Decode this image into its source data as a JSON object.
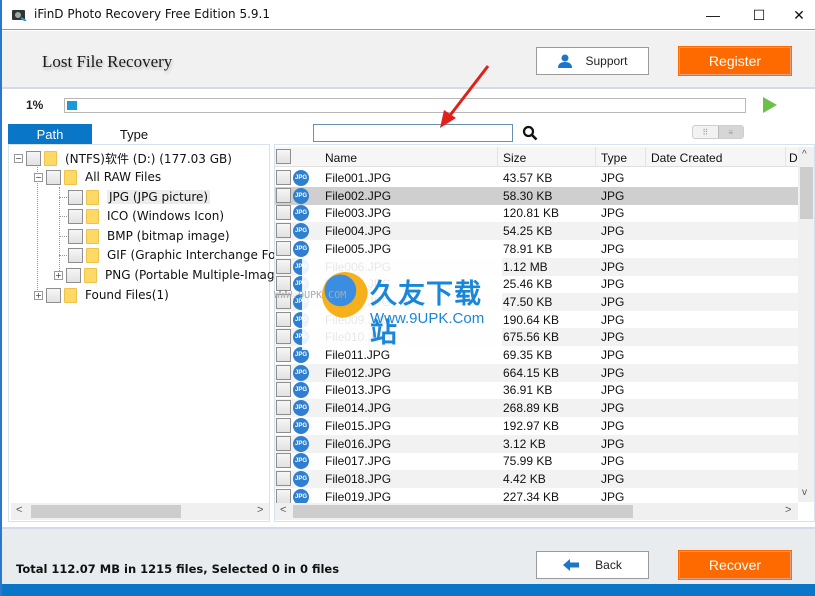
{
  "window": {
    "title": "iFinD Photo Recovery Free Edition 5.9.1",
    "controls": {
      "minimize": "—",
      "maximize": "☐",
      "close": "✕"
    }
  },
  "header": {
    "title": "Lost File Recovery",
    "support_label": "Support",
    "register_label": "Register"
  },
  "progress": {
    "percent_label": "1%",
    "value_percent": 1
  },
  "tabs": [
    {
      "label": "Path",
      "active": true
    },
    {
      "label": "Type",
      "active": false
    }
  ],
  "search": {
    "value": "",
    "placeholder": ""
  },
  "view_toggle": {
    "grid": "⠿",
    "list": "≡",
    "active": "list"
  },
  "tree": {
    "drive": "(NTFS)软件 (D:) (177.03 GB)",
    "raw_group": "All RAW Files",
    "types": [
      {
        "label": "JPG (JPG picture)",
        "selected": true
      },
      {
        "label": "ICO (Windows Icon)"
      },
      {
        "label": "BMP (bitmap image)"
      },
      {
        "label": "GIF (Graphic Interchange For"
      },
      {
        "label": "PNG (Portable Multiple-Imag"
      }
    ],
    "found": "Found Files(1)"
  },
  "list": {
    "columns": [
      "Name",
      "Size",
      "Type",
      "Date Created",
      "D"
    ],
    "rows": [
      {
        "name": "File001.JPG",
        "size": "43.57 KB",
        "type": "JPG"
      },
      {
        "name": "File002.JPG",
        "size": "58.30 KB",
        "type": "JPG",
        "selected": true
      },
      {
        "name": "File003.JPG",
        "size": "120.81 KB",
        "type": "JPG"
      },
      {
        "name": "File004.JPG",
        "size": "54.25 KB",
        "type": "JPG"
      },
      {
        "name": "File005.JPG",
        "size": "78.91 KB",
        "type": "JPG"
      },
      {
        "name": "File006.JPG",
        "size": "1.12 MB",
        "type": "JPG"
      },
      {
        "name": "File007.JPG",
        "size": "25.46 KB",
        "type": "JPG"
      },
      {
        "name": "File008.JPG",
        "size": "47.50 KB",
        "type": "JPG"
      },
      {
        "name": "File009.JPG",
        "size": "190.64 KB",
        "type": "JPG"
      },
      {
        "name": "File010.JPG",
        "size": "675.56 KB",
        "type": "JPG"
      },
      {
        "name": "File011.JPG",
        "size": "69.35 KB",
        "type": "JPG"
      },
      {
        "name": "File012.JPG",
        "size": "664.15 KB",
        "type": "JPG"
      },
      {
        "name": "File013.JPG",
        "size": "36.91 KB",
        "type": "JPG"
      },
      {
        "name": "File014.JPG",
        "size": "268.89 KB",
        "type": "JPG"
      },
      {
        "name": "File015.JPG",
        "size": "192.97 KB",
        "type": "JPG"
      },
      {
        "name": "File016.JPG",
        "size": "3.12 KB",
        "type": "JPG"
      },
      {
        "name": "File017.JPG",
        "size": "75.99 KB",
        "type": "JPG"
      },
      {
        "name": "File018.JPG",
        "size": "4.42 KB",
        "type": "JPG"
      },
      {
        "name": "File019.JPG",
        "size": "227.34 KB",
        "type": "JPG"
      }
    ],
    "file_icon_label": "JPG"
  },
  "watermark": {
    "title": "久友下载站",
    "url": "Www.9UPK.Com",
    "small": "WWW.9UPK.COM"
  },
  "footer": {
    "total": "Total 112.07 MB in 1215 files,  Selected 0 in 0 files",
    "back_label": "Back",
    "recover_label": "Recover"
  },
  "colors": {
    "accent_blue": "#0a76c8",
    "orange": "#ff6a00",
    "progress": "#1b9ad6",
    "play_green": "#6cc04a"
  }
}
